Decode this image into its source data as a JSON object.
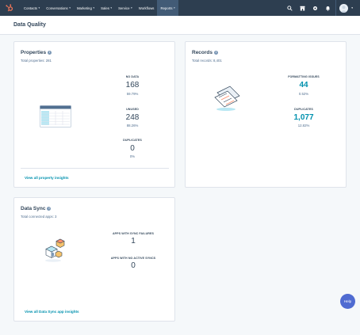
{
  "nav": {
    "items": [
      {
        "label": "Contacts",
        "dropdown": true
      },
      {
        "label": "Conversations",
        "dropdown": true
      },
      {
        "label": "Marketing",
        "dropdown": true
      },
      {
        "label": "Sales",
        "dropdown": true
      },
      {
        "label": "Service",
        "dropdown": true
      },
      {
        "label": "Workflows",
        "dropdown": false
      },
      {
        "label": "Reports",
        "dropdown": true,
        "active": true
      }
    ],
    "right_icons": [
      "search-icon",
      "marketplace-icon",
      "settings-icon",
      "notifications-icon"
    ]
  },
  "header": {
    "title": "Data Quality"
  },
  "properties": {
    "title": "Properties",
    "subtitle": "Total properties: 281",
    "stats": [
      {
        "label": "NO DATA",
        "value": "168",
        "pct": "59.79%"
      },
      {
        "label": "UNUSED",
        "value": "248",
        "pct": "88.26%"
      },
      {
        "label": "DUPLICATES",
        "value": "0",
        "pct": "0%"
      }
    ],
    "link": "View all property insights"
  },
  "records": {
    "title": "Records",
    "subtitle": "Total records: 8,401",
    "stats": [
      {
        "label": "FORMATTING ISSUES",
        "value": "44",
        "pct": "0.52%"
      },
      {
        "label": "DUPLICATES",
        "value": "1,077",
        "pct": "12.82%"
      }
    ]
  },
  "datasync": {
    "title": "Data Sync",
    "subtitle": "Total connected apps: 3",
    "stats": [
      {
        "label": "APPS WITH SYNC FAILURES",
        "value": "1"
      },
      {
        "label": "APPS WITH NO ACTIVE SYNCS",
        "value": "0"
      }
    ],
    "link": "View all Data Sync app insights"
  },
  "help": {
    "label": "Help"
  },
  "colors": {
    "nav_bg": "#2d3e50",
    "accent_teal": "#0091ae",
    "help_bg": "#4f6bd1",
    "page_bg": "#f5f8fa"
  }
}
